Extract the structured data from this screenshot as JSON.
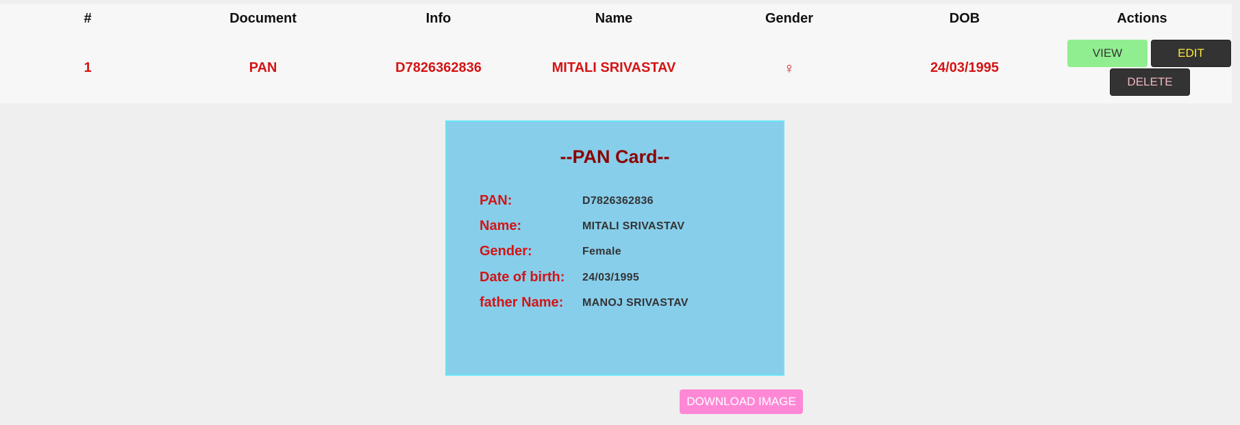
{
  "table": {
    "headers": [
      "#",
      "Document",
      "Info",
      "Name",
      "Gender",
      "DOB",
      "Actions"
    ],
    "rows": [
      {
        "index": "1",
        "document": "PAN",
        "info": "D7826362836",
        "name": "MITALI SRIVASTAV",
        "gender_icon": "♀",
        "dob": "24/03/1995"
      }
    ],
    "actions": {
      "view_label": "VIEW",
      "edit_label": "EDIT",
      "delete_label": "DELETE"
    }
  },
  "card": {
    "title": "--PAN Card--",
    "fields": [
      {
        "label": "PAN:",
        "value": "D7826362836"
      },
      {
        "label": "Name:",
        "value": "MITALI SRIVASTAV"
      },
      {
        "label": "Gender:",
        "value": "Female"
      },
      {
        "label": "Date of birth:",
        "value": "24/03/1995"
      },
      {
        "label": "father Name:",
        "value": "MANOJ SRIVASTAV"
      }
    ]
  },
  "download_label": "DOWNLOAD IMAGE",
  "colors": {
    "accent_red": "#d41414",
    "card_bg": "#87ceeb",
    "title_dark_red": "#8b0000",
    "view_green": "#90ee90",
    "download_pink": "#ff88d6"
  }
}
